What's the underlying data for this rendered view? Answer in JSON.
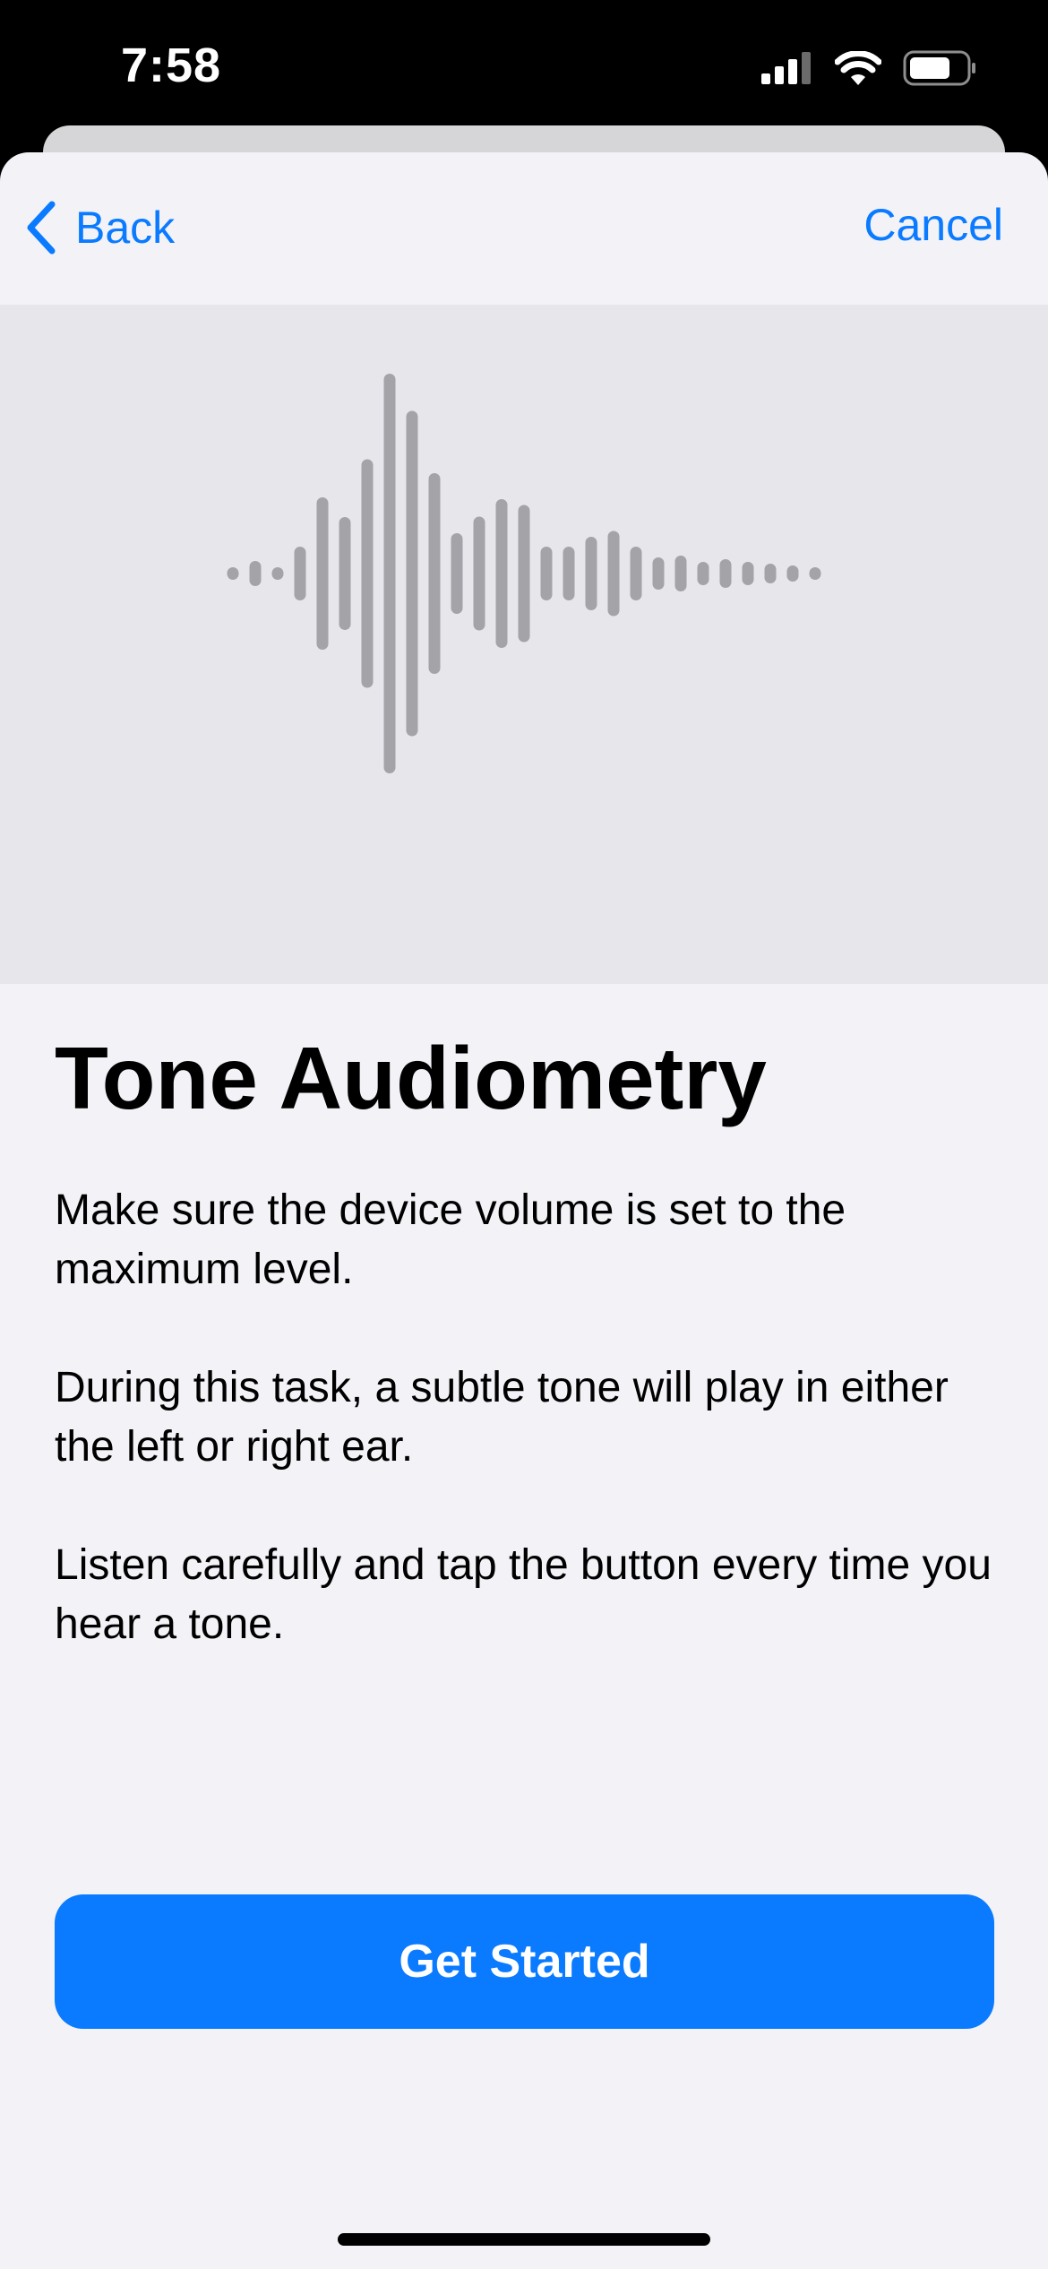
{
  "status_bar": {
    "time": "7:58"
  },
  "nav": {
    "back_label": "Back",
    "cancel_label": "Cancel"
  },
  "hero": {
    "icon": "waveform-icon"
  },
  "content": {
    "title": "Tone Audiometry",
    "paragraphs": [
      "Make sure the device volume is set to the maximum level.",
      "During this task, a subtle tone will play in either the left or right ear.",
      "Listen carefully and tap the button every time you hear a tone."
    ]
  },
  "button": {
    "label": "Get Started"
  },
  "colors": {
    "accent": "#0A7AFF",
    "background": "#F2F2F7",
    "hero_background": "#E6E6EB",
    "waveform": "#A3A3A8"
  }
}
